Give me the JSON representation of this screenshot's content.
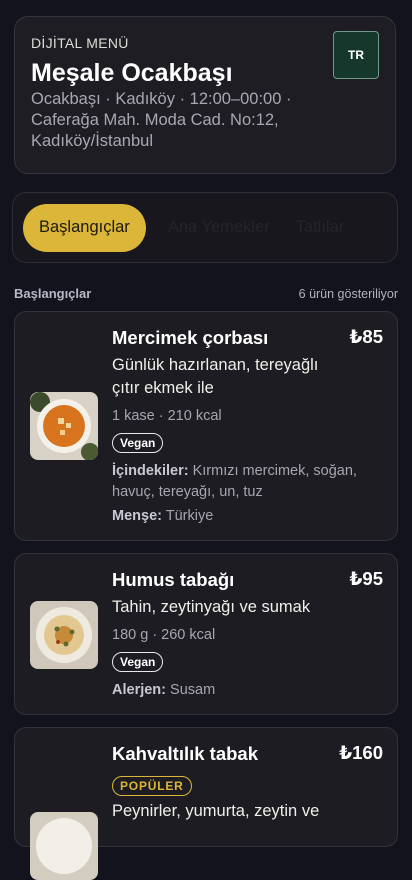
{
  "header": {
    "eyebrow": "DİJİTAL MENÜ",
    "restaurant_name": "Meşale Ocakbaşı",
    "meta": "Ocakbaşı · Kadıköy · 12:00–00:00 · Caferağa Mah. Moda Cad. No:12, Kadıköy/İstanbul",
    "language_button": "TR"
  },
  "tabs": [
    {
      "label": "Başlangıçlar",
      "active": true
    },
    {
      "label": "Ana Yemekler",
      "active": false
    },
    {
      "label": "Tatlılar",
      "active": false
    }
  ],
  "section": {
    "title": "Başlangıçlar",
    "count_text": "6 ürün gösteriliyor"
  },
  "items": [
    {
      "name": "Mercimek çorbası",
      "price": "₺85",
      "description": "Günlük hazırlanan, tereyağlı çıtır ekmek ile",
      "detail": "1 kase · 210 kcal",
      "badge": "Vegan",
      "ingredients_label": "İçindekiler:",
      "ingredients": "Kırmızı mercimek, soğan, havuç, tereyağı, un, tuz",
      "origin_label": "Menşe:",
      "origin": "Türkiye",
      "image_icon": "lentil-soup-image"
    },
    {
      "name": "Humus tabağı",
      "price": "₺95",
      "description": "Tahin, zeytinyağı ve sumak",
      "detail": "180 g · 260 kcal",
      "badge": "Vegan",
      "allergen_label": "Alerjen:",
      "allergen": "Susam",
      "image_icon": "hummus-image"
    },
    {
      "name": "Kahvaltılık tabak",
      "price": "₺160",
      "badge": "POPÜLER",
      "description": "Peynirler, yumurta, zeytin ve",
      "image_icon": "breakfast-plate-image"
    }
  ],
  "colors": {
    "background": "#12131d",
    "card": "#1c1c22",
    "accent": "#dcb638",
    "language_button_bg": "#16382c"
  }
}
